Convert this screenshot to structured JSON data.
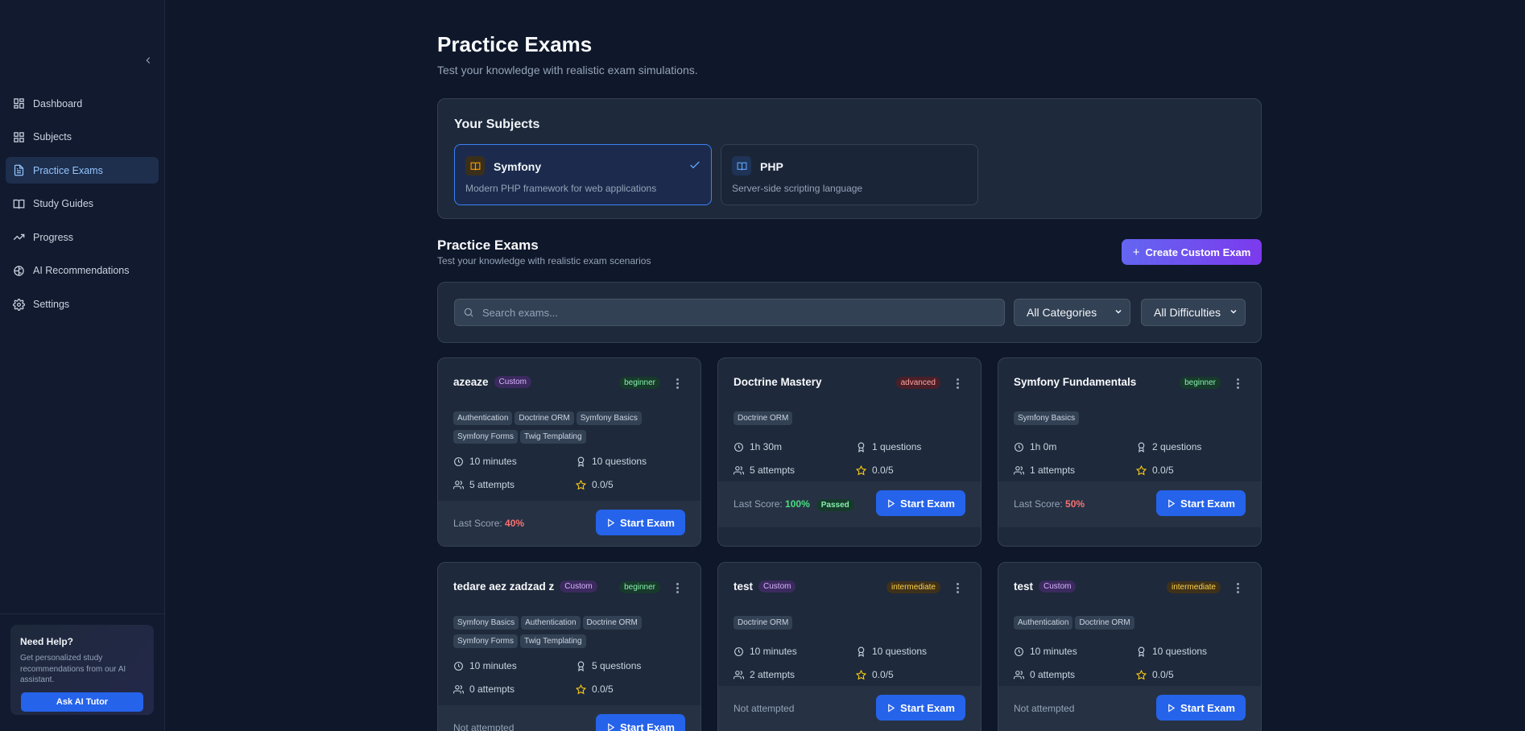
{
  "sidebar": {
    "items": [
      {
        "label": "Dashboard",
        "icon": "dashboard-icon",
        "active": false
      },
      {
        "label": "Subjects",
        "icon": "grid-icon",
        "active": false
      },
      {
        "label": "Practice Exams",
        "icon": "document-icon",
        "active": true
      },
      {
        "label": "Study Guides",
        "icon": "book-icon",
        "active": false
      },
      {
        "label": "Progress",
        "icon": "trending-up-icon",
        "active": false
      },
      {
        "label": "AI Recommendations",
        "icon": "brain-icon",
        "active": false
      },
      {
        "label": "Settings",
        "icon": "gear-icon",
        "active": false
      }
    ],
    "help": {
      "title": "Need Help?",
      "text": "Get personalized study recommendations from our AI assistant.",
      "button": "Ask AI Tutor"
    }
  },
  "header": {
    "title": "Practice Exams",
    "subtitle": "Test your knowledge with realistic exam simulations."
  },
  "subjects": {
    "title": "Your Subjects",
    "items": [
      {
        "name": "Symfony",
        "description": "Modern PHP framework for web applications",
        "selected": true,
        "icon_color": "#f59e0b"
      },
      {
        "name": "PHP",
        "description": "Server-side scripting language",
        "selected": false,
        "icon_color": "#60a5fa"
      }
    ]
  },
  "exams_section": {
    "title": "Practice Exams",
    "subtitle": "Test your knowledge with realistic exam scenarios",
    "create_button": "Create Custom Exam"
  },
  "filters": {
    "search_placeholder": "Search exams...",
    "category": "All Categories",
    "difficulty": "All Difficulties"
  },
  "exams": [
    {
      "title": "azeaze",
      "custom_label": "Custom",
      "difficulty": "beginner",
      "tags": [
        "Authentication",
        "Doctrine ORM",
        "Symfony Basics",
        "Symfony Forms",
        "Twig Templating"
      ],
      "duration": "10 minutes",
      "questions": "10 questions",
      "attempts": "5 attempts",
      "rating": "0.0/5",
      "score_label": "Last Score:",
      "score": "40%",
      "passed": "",
      "button": "Start Exam"
    },
    {
      "title": "Doctrine Mastery",
      "custom_label": "",
      "difficulty": "advanced",
      "tags": [
        "Doctrine ORM"
      ],
      "duration": "1h 30m",
      "questions": "1 questions",
      "attempts": "5 attempts",
      "rating": "0.0/5",
      "score_label": "Last Score:",
      "score": "100%",
      "passed": "Passed",
      "button": "Start Exam"
    },
    {
      "title": "Symfony Fundamentals",
      "custom_label": "",
      "difficulty": "beginner",
      "tags": [
        "Symfony Basics"
      ],
      "duration": "1h 0m",
      "questions": "2 questions",
      "attempts": "1 attempts",
      "rating": "0.0/5",
      "score_label": "Last Score:",
      "score": "50%",
      "passed": "",
      "button": "Start Exam"
    },
    {
      "title": "tedare aez zadzad z",
      "custom_label": "Custom",
      "difficulty": "beginner",
      "tags": [
        "Symfony Basics",
        "Authentication",
        "Doctrine ORM",
        "Symfony Forms",
        "Twig Templating"
      ],
      "duration": "10 minutes",
      "questions": "5 questions",
      "attempts": "0 attempts",
      "rating": "0.0/5",
      "score_label": "Not attempted",
      "score": "",
      "passed": "",
      "button": "Start Exam"
    },
    {
      "title": "test",
      "custom_label": "Custom",
      "difficulty": "intermediate",
      "tags": [
        "Doctrine ORM"
      ],
      "duration": "10 minutes",
      "questions": "10 questions",
      "attempts": "2 attempts",
      "rating": "0.0/5",
      "score_label": "Not attempted",
      "score": "",
      "passed": "",
      "button": "Start Exam"
    },
    {
      "title": "test",
      "custom_label": "Custom",
      "difficulty": "intermediate",
      "tags": [
        "Authentication",
        "Doctrine ORM"
      ],
      "duration": "10 minutes",
      "questions": "10 questions",
      "attempts": "0 attempts",
      "rating": "0.0/5",
      "score_label": "Not attempted",
      "score": "",
      "passed": "",
      "button": "Start Exam"
    }
  ]
}
